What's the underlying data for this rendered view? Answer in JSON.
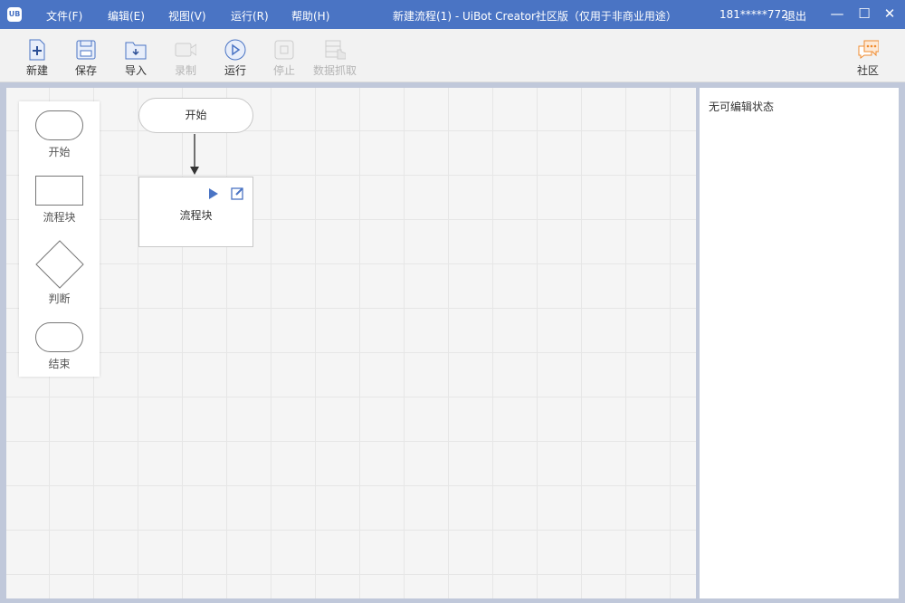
{
  "titlebar": {
    "logo": "UB",
    "menus": [
      "文件(F)",
      "编辑(E)",
      "视图(V)",
      "运行(R)",
      "帮助(H)"
    ],
    "title": "新建流程(1) - UiBot Creator社区版（仅用于非商业用途）",
    "user": "181*****772",
    "logout": "退出"
  },
  "toolbar": {
    "new": "新建",
    "save": "保存",
    "import": "导入",
    "record": "录制",
    "run": "运行",
    "stop": "停止",
    "scrape": "数据抓取",
    "community": "社区"
  },
  "palette": {
    "start": "开始",
    "block": "流程块",
    "decision": "判断",
    "end": "结束"
  },
  "flow": {
    "start": "开始",
    "block": "流程块"
  },
  "panel": {
    "status": "无可编辑状态"
  },
  "colors": {
    "accent": "#4a74c4",
    "community": "#f08c30"
  }
}
